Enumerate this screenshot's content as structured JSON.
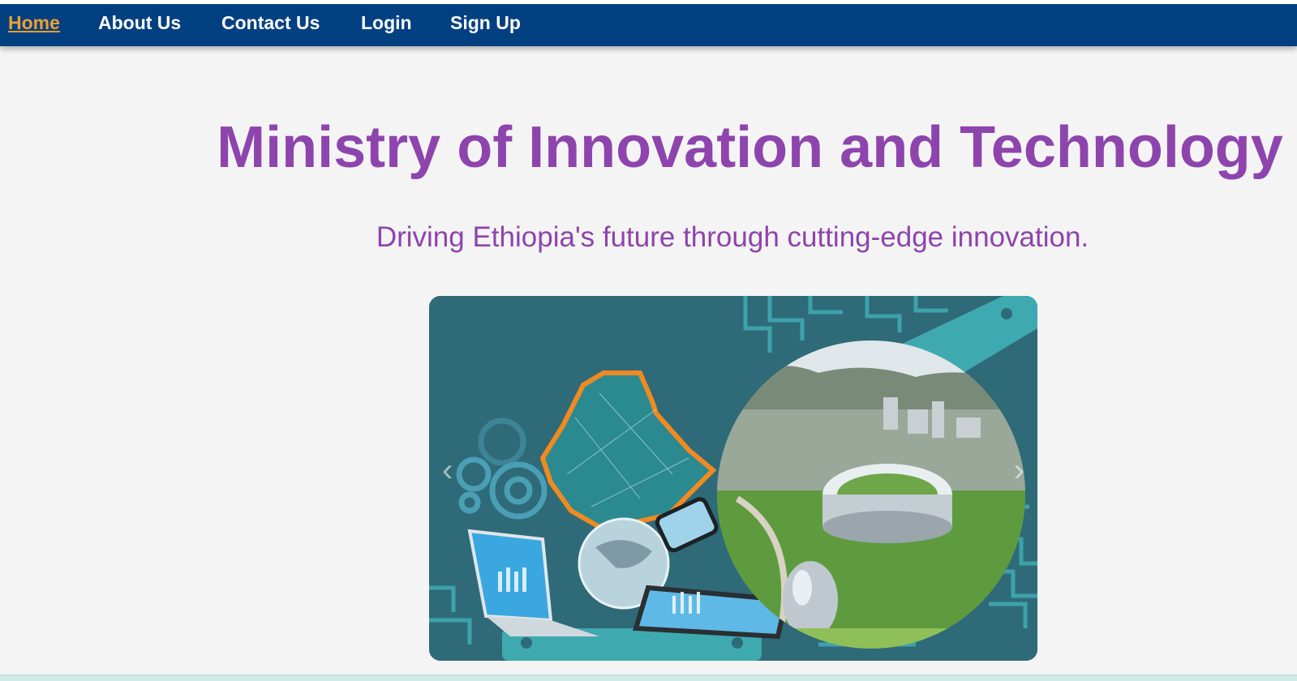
{
  "nav": {
    "items": [
      {
        "label": "Home",
        "active": true
      },
      {
        "label": "About Us",
        "active": false
      },
      {
        "label": "Contact Us",
        "active": false
      },
      {
        "label": "Login",
        "active": false
      },
      {
        "label": "Sign Up",
        "active": false
      }
    ]
  },
  "hero": {
    "title": "Ministry of Innovation and Technology",
    "subtitle": "Driving Ethiopia's future through cutting-edge innovation."
  },
  "slider": {
    "prev_icon": "chevron-left-icon",
    "next_icon": "chevron-right-icon",
    "prev_glyph": "‹",
    "next_glyph": "›"
  },
  "colors": {
    "navbar": "#004080",
    "nav_text": "#ffffff",
    "nav_active": "#f0a030",
    "heading": "#8e44ad",
    "slide_bg": "#2f6a78",
    "circuit": "#3fa9b0"
  }
}
